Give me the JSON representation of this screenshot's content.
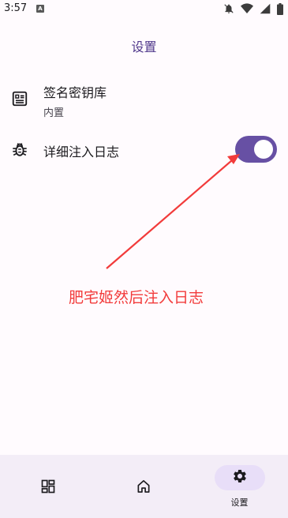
{
  "status_bar": {
    "time": "3:57",
    "notification_badge": "A",
    "icons": [
      "notifications-off-icon",
      "wifi-icon",
      "cellular-signal-icon",
      "battery-icon"
    ]
  },
  "page": {
    "title": "设置"
  },
  "settings": {
    "keystore": {
      "icon": "keystore-card-icon",
      "title": "签名密钥库",
      "subtitle": "内置"
    },
    "verbose_log": {
      "icon": "bug-icon",
      "title": "详细注入日志",
      "enabled": true
    }
  },
  "annotation": {
    "text": "肥宅姬然后注入日志",
    "color": "#F23B3B"
  },
  "bottom_nav": {
    "items": [
      {
        "icon": "dashboard-icon",
        "label": "",
        "selected": false
      },
      {
        "icon": "home-icon",
        "label": "",
        "selected": false
      },
      {
        "icon": "gear-icon",
        "label": "设置",
        "selected": true
      }
    ]
  },
  "colors": {
    "background": "#FFFBFE",
    "accent": "#6750A4",
    "title": "#4F378B",
    "nav_background": "#F3EDF7",
    "nav_indicator": "#E8DEF8"
  }
}
